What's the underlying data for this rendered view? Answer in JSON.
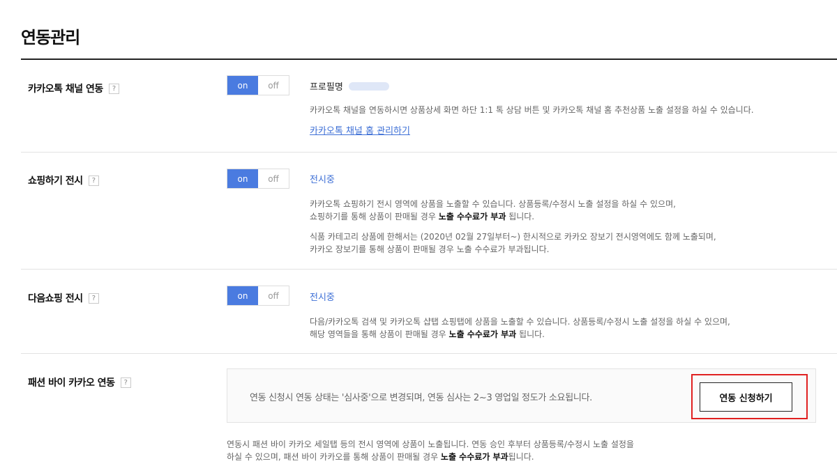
{
  "page": {
    "title": "연동관리"
  },
  "toggle": {
    "on": "on",
    "off": "off"
  },
  "help_glyph": "?",
  "kakao_channel": {
    "label": "카카오톡 채널 연동",
    "profile_label": "프로필명",
    "desc": "카카오톡 채널을 연동하시면 상품상세 화면 하단 1:1 톡 상담 버튼 및 카카오톡 채널 홈 추천상품 노출 설정을 하실 수 있습니다.",
    "link": "카카오톡 채널 홈 관리하기"
  },
  "shopping": {
    "label": "쇼핑하기 전시",
    "status": "전시중",
    "desc1_line1": "카카오톡 쇼핑하기 전시 영역에 상품을 노출할 수 있습니다. 상품등록/수정시 노출 설정을 하실 수 있으며,",
    "desc1_line2_pre": "쇼핑하기를 통해 상품이 판매될 경우 ",
    "desc1_line2_bold": "노출 수수료가 부과",
    "desc1_line2_post": " 됩니다.",
    "desc2_line1": "식품 카테고리 상품에 한해서는 (2020년 02월 27일부터~) 한시적으로 카카오 장보기 전시영역에도 함께 노출되며,",
    "desc2_line2": "카카오 장보기를 통해 상품이 판매될 경우 노출 수수료가 부과됩니다."
  },
  "daum": {
    "label": "다음쇼핑 전시",
    "status": "전시중",
    "desc_line1": "다음/카카오톡 검색 및 카카오톡 샵탭 쇼핑탭에 상품을 노출할 수 있습니다. 상품등록/수정시 노출 설정을 하실 수 있으며,",
    "desc_line2_pre": "해당 영역들을 통해 상품이 판매될 경우 ",
    "desc_line2_bold": "노출 수수료가 부과",
    "desc_line2_post": " 됩니다."
  },
  "fashion": {
    "label": "패션 바이 카카오 연동",
    "box_text": "연동 신청시 연동 상태는 '심사중'으로 변경되며, 연동 심사는 2~3 영업일 정도가 소요됩니다.",
    "button": "연동 신청하기",
    "desc_line1": "연동시 패션 바이 카카오 세일탭 등의 전시 영역에 상품이 노출됩니다. 연동 승인 후부터 상품등록/수정시 노출 설정을",
    "desc_line2_pre": "하실 수 있으며, 패션 바이 카카오를 통해 상품이 판매될 경우 ",
    "desc_line2_bold": "노출 수수료가 부과",
    "desc_line2_post": "됩니다."
  }
}
